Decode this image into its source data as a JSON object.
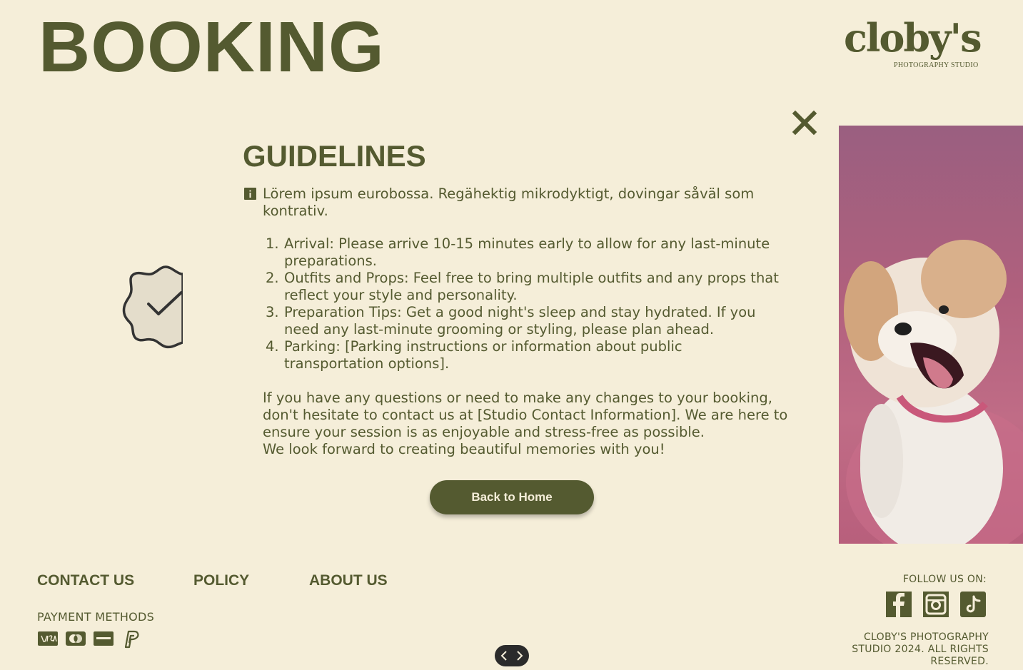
{
  "header": {
    "title": "BOOKING",
    "logo_wordmark": "cloby's",
    "logo_subtitle": "PHOTOGRAPHY STUDIO"
  },
  "modal": {
    "title": "GUIDELINES",
    "intro": "Lörem ipsum eurobossa. Regähektig mikrodyktigt, dovingar såväl som kontrativ.",
    "rules": [
      {
        "num": "1.",
        "text": "Arrival: Please arrive 10-15 minutes early to allow for any last-minute preparations."
      },
      {
        "num": "2.",
        "text": "Outfits and Props: Feel free to bring multiple outfits and any props that reflect your style and personality."
      },
      {
        "num": "3.",
        "text": "Preparation Tips: Get a good night's sleep and stay hydrated. If you need any last-minute grooming or styling, please plan ahead."
      },
      {
        "num": "4.",
        "text": "Parking: [Parking instructions or information about public transportation options]."
      }
    ],
    "closing_1": "If you have any questions or need to make any changes to your booking, don't hesitate to contact us at [Studio Contact Information]. We are here to ensure your session is as enjoyable and stress-free as possible.",
    "closing_2": "We look forward to creating beautiful memories with you!",
    "back_button": "Back to Home"
  },
  "footer": {
    "links": [
      "CONTACT US",
      "POLICY",
      "ABOUT US"
    ],
    "payment_label": "PAYMENT METHODS",
    "payment_icons": [
      "visa-icon",
      "mastercard-icon",
      "amex-icon",
      "paypal-icon"
    ],
    "follow_label": "FOLLOW US ON:",
    "social_icons": [
      "facebook-icon",
      "instagram-icon",
      "tiktok-icon"
    ],
    "copyright": "CLOBY'S PHOTOGRAPHY STUDIO 2024. ALL RIGHTS RESERVED."
  },
  "colors": {
    "background": "#f5eed9",
    "primary": "#545a30",
    "photo_bg": "#b0607d"
  }
}
